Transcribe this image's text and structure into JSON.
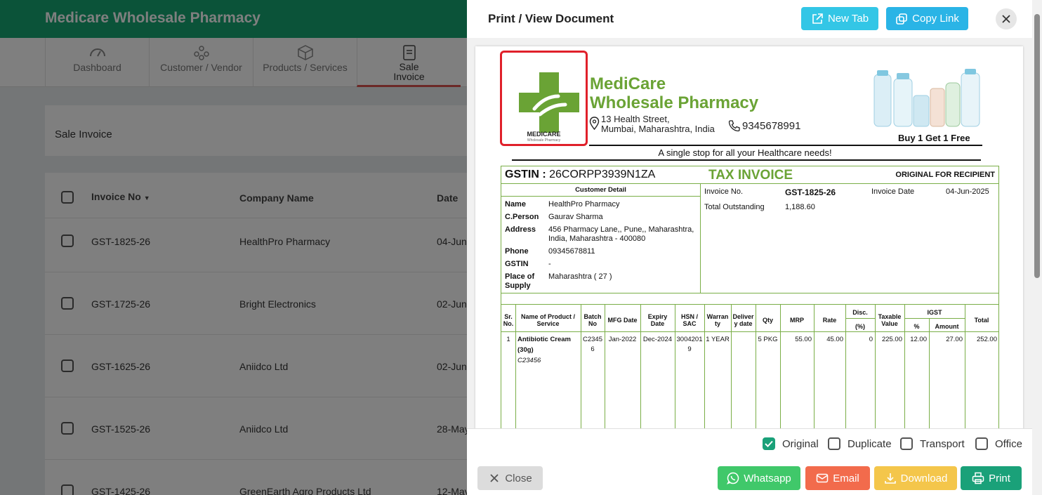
{
  "app": {
    "title": "Medicare Wholesale Pharmacy",
    "nav": [
      {
        "label": "Dashboard",
        "icon": "speedometer-icon"
      },
      {
        "label": "Customer / Vendor",
        "icon": "people-icon"
      },
      {
        "label": "Products / Services",
        "icon": "box-icon"
      },
      {
        "label": "Sale Invoice",
        "icon": "invoice-icon",
        "active": true
      }
    ]
  },
  "list": {
    "title": "Sale Invoice",
    "columns": [
      "Invoice No",
      "Company Name",
      "Date"
    ],
    "rows": [
      {
        "invoice": "GST-1825-26",
        "company": "HealthPro Pharmacy",
        "date": "04-Jun-"
      },
      {
        "invoice": "GST-1725-26",
        "company": "Bright Electronics",
        "date": "02-Jun-"
      },
      {
        "invoice": "GST-1625-26",
        "company": "Aniidco Ltd",
        "date": "02-Jun-"
      },
      {
        "invoice": "GST-1525-26",
        "company": "Aniidco Ltd",
        "date": "28-May"
      },
      {
        "invoice": "GST-1425-26",
        "company": "GreenEarth Agro Products Ltd",
        "date": "12-May"
      }
    ]
  },
  "modal": {
    "title": "Print / View Document",
    "new_tab": "New Tab",
    "copy_link": "Copy Link",
    "close": "Close",
    "whatsapp": "Whatsapp",
    "email": "Email",
    "download": "Download",
    "print": "Print",
    "copy_options": [
      {
        "label": "Original",
        "checked": true
      },
      {
        "label": "Duplicate",
        "checked": false
      },
      {
        "label": "Transport",
        "checked": false
      },
      {
        "label": "Office",
        "checked": false
      }
    ]
  },
  "invoice": {
    "logo_word": "MEDICARE",
    "logo_sub": "Wholesale Pharmacy",
    "company_line1": "MediCare",
    "company_line2": "Wholesale Pharmacy",
    "address_line1": "13 Health Street,",
    "address_line2": "Mumbai, Maharashtra, India",
    "phone": "9345678991",
    "promo": "Buy 1 Get 1 Free",
    "tagline": "A single stop for all your Healthcare needs!",
    "gstin_label": "GSTIN :",
    "gstin_value": "26CORPP3939N1ZA",
    "doc_title": "TAX INVOICE",
    "copy_type": "ORIGINAL FOR RECIPIENT",
    "customer_detail_title": "Customer Detail",
    "customer": {
      "name_label": "Name",
      "name": "HealthPro Pharmacy",
      "cperson_label": "C.Person",
      "cperson": "Gaurav Sharma",
      "address_label": "Address",
      "address_line1": "456 Pharmacy Lane,, Pune,, Maharashtra,",
      "address_line2": "India, Maharashtra - 400080",
      "phone_label": "Phone",
      "phone": "09345678811",
      "gstin_label": "GSTIN",
      "gstin": "-",
      "pos_label1": "Place of",
      "pos_label2": "Supply",
      "pos": "Maharashtra ( 27 )"
    },
    "meta": {
      "invoice_no_label": "Invoice No.",
      "invoice_no": "GST-1825-26",
      "invoice_date_label": "Invoice Date",
      "invoice_date": "04-Jun-2025",
      "outstanding_label": "Total Outstanding",
      "outstanding": "1,188.60"
    },
    "item_headers": {
      "sr1": "Sr.",
      "sr2": "No.",
      "name1": "Name of Product /",
      "name2": "Service",
      "batch1": "Batch",
      "batch2": "No",
      "mfg": "MFG Date",
      "exp1": "Expiry",
      "exp2": "Date",
      "hsn1": "HSN /",
      "hsn2": "SAC",
      "war1": "Warran",
      "war2": "ty",
      "del1": "Deliver",
      "del2": "y date",
      "qty": "Qty",
      "mrp": "MRP",
      "rate": "Rate",
      "disc": "Disc.",
      "disc_pct": "(%)",
      "taxable1": "Taxable",
      "taxable2": "Value",
      "igst": "IGST",
      "igst_pct": "%",
      "igst_amt": "Amount",
      "total": "Total"
    },
    "items": [
      {
        "sr": "1",
        "name1": "Antibiotic Cream",
        "name2": "(30g)",
        "code": "C23456",
        "batch1": "C2345",
        "batch2": "6",
        "mfg": "Jan-2022",
        "expiry": "Dec-2024",
        "hsn1": "3004201",
        "hsn2": "9",
        "warranty": "1 YEAR",
        "delivery": "",
        "qty": "5 PKG",
        "mrp": "55.00",
        "rate": "45.00",
        "disc": "0",
        "taxable": "225.00",
        "igst_pct": "12.00",
        "igst_amt": "27.00",
        "total": "252.00"
      }
    ]
  }
}
